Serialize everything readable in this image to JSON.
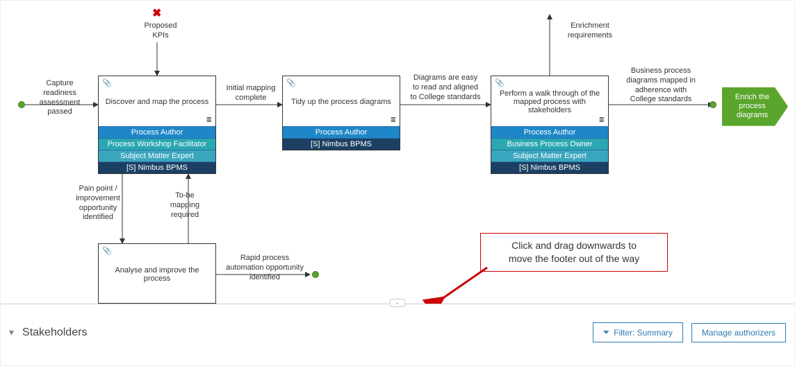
{
  "diagram": {
    "input_label": "Capture\nreadiness\nassessment\npassed",
    "kpi_input": "Proposed\nKPIs",
    "nodes": {
      "discover": {
        "title": "Discover and map the process",
        "roles": [
          "Process Author",
          "Process Workshop Facilitator",
          "Subject Matter Expert",
          "[S] Nimbus BPMS"
        ]
      },
      "tidy": {
        "title": "Tidy up the process diagrams",
        "roles": [
          "Process Author",
          "[S] Nimbus BPMS"
        ]
      },
      "walkthrough": {
        "title": "Perform a walk through of the mapped process with stakeholders",
        "roles": [
          "Process Author",
          "Business Process Owner",
          "Subject Matter Expert",
          "[S] Nimbus BPMS"
        ]
      },
      "analyse": {
        "title": "Analyse and improve the process"
      }
    },
    "edges": {
      "initial_mapping": "Initial mapping\ncomplete",
      "easy_to_read": "Diagrams are easy\nto read and aligned\nto College standards",
      "enrichment_out": "Enrichment\nrequirements",
      "adherence": "Business process\ndiagrams mapped in\nadherence with\nCollege standards",
      "pain_point": "Pain point /\nimprovement\nopportunity\nidentified",
      "tobe_required": "To-be\nmapping\nrequired",
      "rapid_auto": "Rapid process\nautomation opportunity\nidentified"
    },
    "end": "Enrich the\nprocess\ndiagrams"
  },
  "callout": "Click and drag downwards to\nmove the footer out of the way",
  "footer": {
    "title": "Stakeholders",
    "filter_label": "Filter: Summary",
    "manage_label": "Manage authorizers"
  }
}
